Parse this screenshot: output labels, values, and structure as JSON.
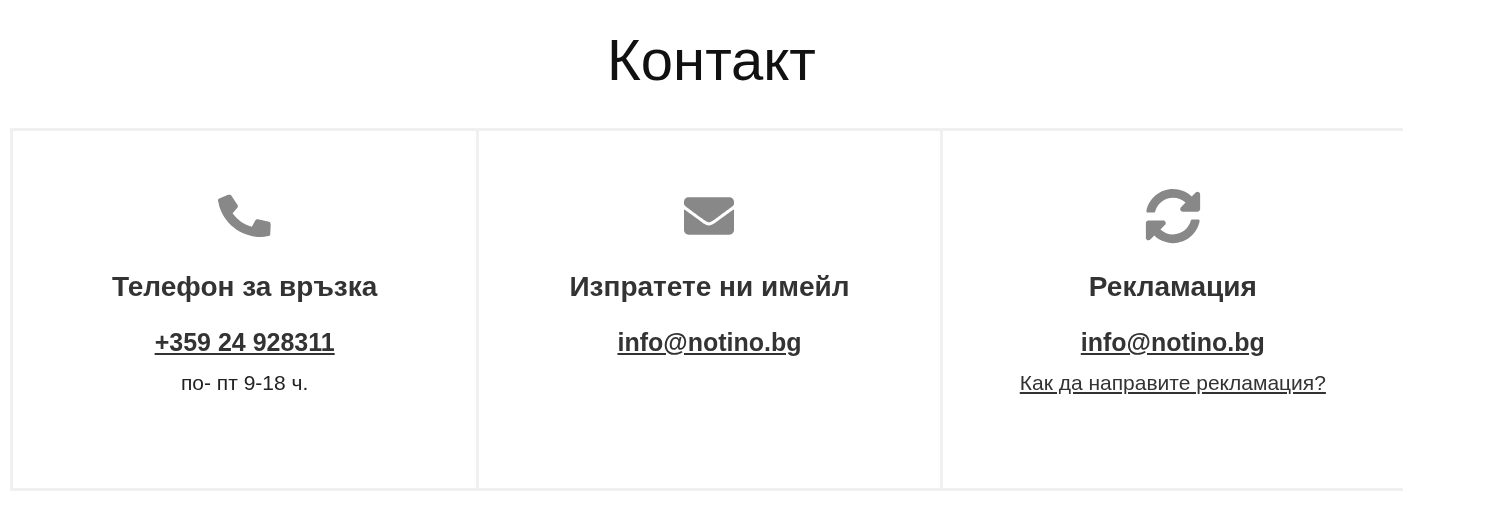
{
  "title": "Контакт",
  "cards": [
    {
      "kind": "phone",
      "heading": "Телефон за връзка",
      "lines": [
        {
          "kind": "main-link",
          "text": "+359 24 928311"
        },
        {
          "kind": "text",
          "text": "по- пт 9-18 ч."
        }
      ]
    },
    {
      "kind": "email",
      "heading": "Изпратете ни имейл",
      "lines": [
        {
          "kind": "main-link",
          "text": "info@notino.bg"
        }
      ]
    },
    {
      "kind": "complaint",
      "heading": "Рекламация",
      "lines": [
        {
          "kind": "main-link",
          "text": "info@notino.bg"
        },
        {
          "kind": "link",
          "text": "Как да направите рекламация?"
        }
      ]
    }
  ]
}
